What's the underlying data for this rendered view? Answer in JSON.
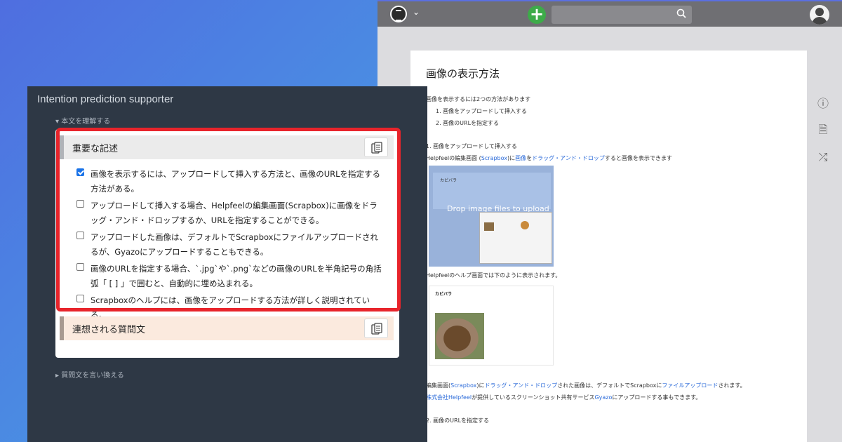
{
  "colors": {
    "highlight": "#e8242b",
    "panel_bg": "#2e3845",
    "link": "#2a6ad9"
  },
  "scrapbox": {
    "header": {
      "logo_icon": "scrapbox-logo-icon",
      "chevron": "⌄",
      "add_icon": "+",
      "search_icon": "search-icon",
      "avatar_icon": "user-avatar-icon"
    },
    "page": {
      "title": "画像の表示方法",
      "lines": [
        "画像を表示するには2つの方法があります",
        "1. 画像をアップロードして挿入する",
        "2. 画像のURLを指定する",
        "1. 画像をアップロードして挿入する"
      ],
      "line5": {
        "pre": "Helpfeelの編集画面 (",
        "link1": "Scrapbox",
        "mid1": ")に",
        "link2": "画像",
        "mid2": "を",
        "link3": "ドラッグ・アンド・ドロップ",
        "post": "すると画像を表示できます"
      },
      "img1": {
        "card_title": "カピバラ",
        "drop_text": "Drop image files to upload"
      },
      "line6": "Helpfeelのヘルプ画面では下のように表示されます。",
      "img2": {
        "card_title": "カピバラ"
      },
      "line7": {
        "pre": "編集画面(",
        "link1": "Scrapbox",
        "mid1": ")に",
        "link2": "ドラッグ・アンド・ドロップ",
        "mid2": "された画像は、デフォルトでScrapboxに",
        "link3": "ファイルアップロード",
        "post": "されます。"
      },
      "line8": {
        "link1": "株式会社Helpfeel",
        "mid1": "が提供しているスクリーンショット共有サービス",
        "link2": "Gyazo",
        "post": "にアップロードする事もできます。"
      },
      "line9": "2. 画像のURLを指定する"
    },
    "side_icons": [
      "ⓘ",
      "🗎",
      "⤮"
    ]
  },
  "panel": {
    "title": "Intention prediction supporter",
    "toggle_open": "▾ 本文を理解する",
    "toggle_closed": "▸ 質問文を言い換える",
    "section_important": "重要な記述",
    "section_related": "連想される質問文",
    "items": [
      {
        "checked": true,
        "text": "画像を表示するには、アップロードして挿入する方法と、画像のURLを指定する方法がある。"
      },
      {
        "checked": false,
        "text": "アップロードして挿入する場合、Helpfeelの編集画面(Scrapbox)に画像をドラッグ・アンド・ドロップするか、URLを指定することができる。"
      },
      {
        "checked": false,
        "text": "アップロードした画像は、デフォルトでScrapboxにファイルアップロードされるが、Gyazoにアップロードすることもできる。"
      },
      {
        "checked": false,
        "text": "画像のURLを指定する場合、`.jpg`や`.png`などの画像のURLを半角記号の角括弧「 [ ] 」で囲むと、自動的に埋め込まれる。"
      },
      {
        "checked": false,
        "text": "Scrapboxのヘルプには、画像をアップロードする方法が詳しく説明されている。"
      }
    ]
  }
}
